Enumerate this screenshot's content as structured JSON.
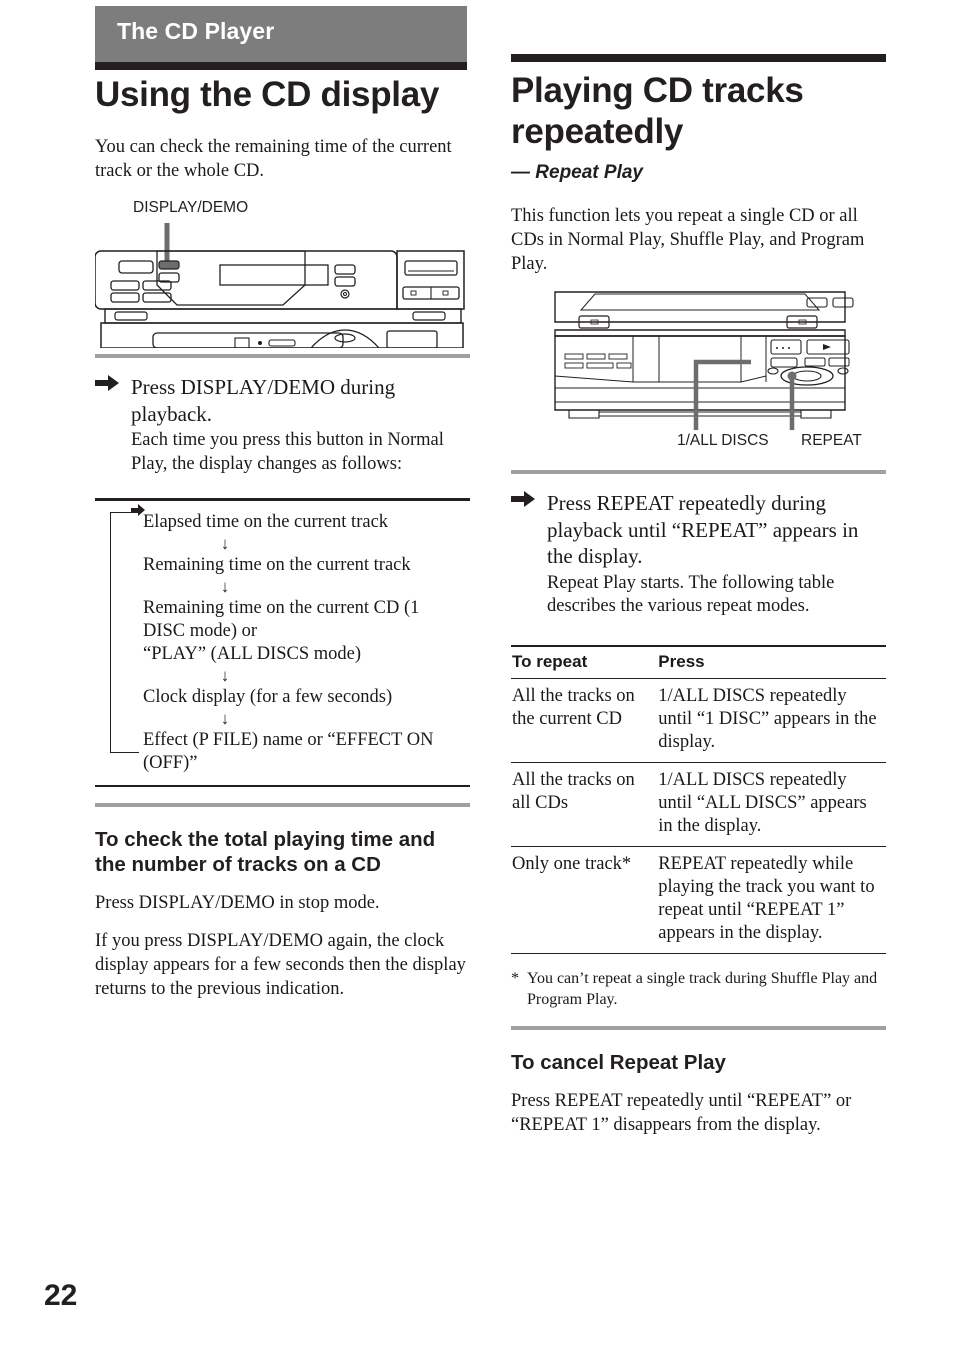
{
  "page": {
    "number": "22"
  },
  "banner": {
    "title": "The CD Player"
  },
  "left_column": {
    "title": "Using the CD display",
    "intro": "You can check the remaining time of the current track or the whole CD.",
    "illustration_label": "DISPLAY/DEMO",
    "step": {
      "arrow_icon": "right-arrow-icon",
      "heading": "Press DISPLAY/DEMO during playback.",
      "detail": "Each time you press this button in Normal Play, the display changes as follows:"
    },
    "flow": {
      "loop_arrow_icon": "loop-arrow-icon",
      "down_arrow": "↓",
      "items": [
        "Elapsed time on the current track",
        "Remaining time on the current track",
        "Remaining time on the current CD (1 DISC mode) or\n“PLAY” (ALL DISCS mode)",
        "Clock display (for a few seconds)",
        "Effect (P FILE) name or “EFFECT ON (OFF)”"
      ]
    },
    "total_time_section": {
      "heading": "To check the total playing time and the number of tracks on a CD",
      "para1": "Press DISPLAY/DEMO in stop mode.",
      "para2": "If you press DISPLAY/DEMO again, the clock display appears for a few seconds then the display returns to the previous indication."
    }
  },
  "right_column": {
    "title": "Playing CD tracks repeatedly",
    "subtitle": "— Repeat Play",
    "intro": "This function lets you repeat a single CD or all CDs in Normal Play, Shuffle Play, and Program Play.",
    "callouts": {
      "left": "1/ALL DISCS",
      "right": "REPEAT"
    },
    "step": {
      "arrow_icon": "right-arrow-icon",
      "heading": "Press REPEAT repeatedly during playback until “REPEAT” appears in the display.",
      "detail": "Repeat Play starts. The following table describes the various repeat modes."
    },
    "table": {
      "headers": [
        "To repeat",
        "Press"
      ],
      "rows": [
        [
          "All the tracks on the current CD",
          "1/ALL DISCS repeatedly until “1 DISC” appears in the display."
        ],
        [
          "All the tracks on all CDs",
          "1/ALL DISCS repeatedly until “ALL DISCS” appears in the display."
        ],
        [
          "Only one track*",
          "REPEAT repeatedly while playing the track you want to repeat until “REPEAT 1” appears in the display."
        ]
      ]
    },
    "footnote": {
      "marker": "*",
      "text": "You can’t repeat a single track during Shuffle Play and Program Play."
    },
    "cancel_section": {
      "heading": "To cancel Repeat Play",
      "para": "Press REPEAT repeatedly until “REPEAT” or “REPEAT 1” disappears from the display."
    }
  },
  "colors": {
    "banner_gray": "#7d7d7d",
    "rule_black": "#231f20",
    "rule_gray": "#a0a0a0",
    "text": "#1a1a1a"
  }
}
